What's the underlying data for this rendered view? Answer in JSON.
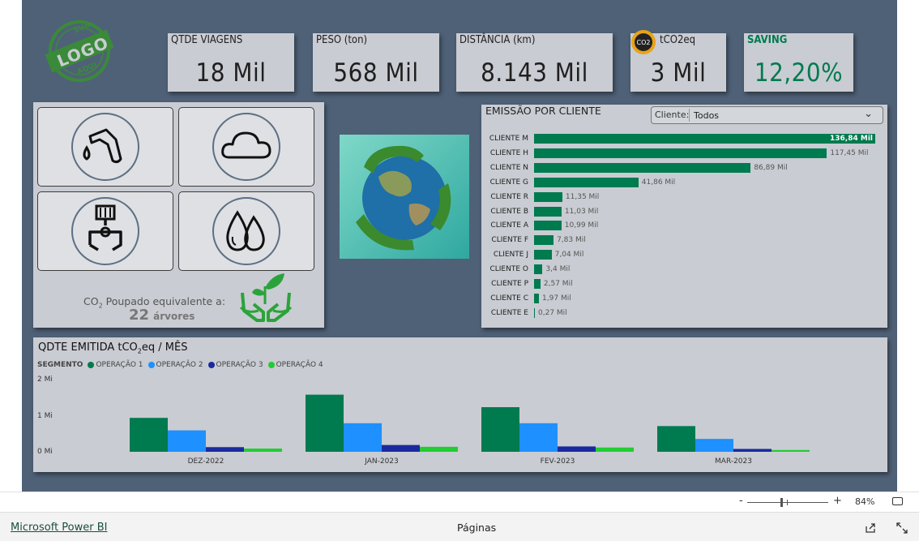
{
  "logo": {
    "line1": "SUA",
    "line2": "LOGO",
    "line3": "AQUI",
    "color": "#3a8a3a"
  },
  "kpis": [
    {
      "title": "QTDE VIAGENS",
      "value": "18 Mil"
    },
    {
      "title": "PESO (ton)",
      "value": "568 Mil"
    },
    {
      "title": "DISTÂNCIA (km)",
      "value": "8.143 Mil"
    },
    {
      "title": "tCO2eq",
      "value": "3 Mil",
      "badge": "CO2"
    },
    {
      "title": "SAVING",
      "value": "12,20%",
      "accent": "#007a4f"
    }
  ],
  "icons": [
    "fuel-pump-icon",
    "cloud-icon",
    "factory-claw-icon",
    "water-drops-icon"
  ],
  "co2_saved": {
    "label_prefix": "CO",
    "label_sub": "2",
    "label_suffix": " Poupado equivalente a:",
    "number": "22",
    "unit": "árvores"
  },
  "emission_by_client": {
    "title": "EMISSÃO POR CLIENTE",
    "filter_label": "Cliente:",
    "filter_value": "Todos",
    "clients": [
      "CLIENTE M",
      "CLIENTE H",
      "CLIENTE N",
      "CLIENTE G",
      "CLIENTE R",
      "CLIENTE B",
      "CLIENTE A",
      "CLIENTE F",
      "CLIENTE J",
      "CLIENTE O",
      "CLIENTE P",
      "CLIENTE C",
      "CLIENTE E"
    ],
    "values": [
      136.84,
      117.45,
      86.89,
      41.86,
      11.35,
      11.03,
      10.99,
      7.83,
      7.04,
      3.4,
      2.57,
      1.97,
      0.27
    ],
    "labels": [
      "136,84 Mil",
      "117,45 Mil",
      "86,89 Mil",
      "41,86 Mil",
      "11,35 Mil",
      "11,03 Mil",
      "10,99 Mil",
      "7,83 Mil",
      "7,04 Mil",
      "3,4 Mil",
      "2,57 Mil",
      "1,97 Mil",
      "0,27 Mil"
    ],
    "color": "#007a4f"
  },
  "monthly": {
    "title_prefix": "QDTE EMITIDA tCO",
    "title_sub": "2",
    "title_suffix": "eq / MÊS",
    "legend_title": "SEGMENTO",
    "series_names": [
      "OPERAÇÃO 1",
      "OPERAÇÃO 2",
      "OPERAÇÃO 3",
      "OPERAÇÃO 4"
    ],
    "series_colors": [
      "#007a4f",
      "#1e90ff",
      "#1a2a9e",
      "#22cc33"
    ],
    "y_ticks": [
      "2 Mi",
      "1 Mi",
      "0 Mi"
    ]
  },
  "chart_data": [
    {
      "type": "bar",
      "title": "EMISSÃO POR CLIENTE",
      "categories": [
        "CLIENTE M",
        "CLIENTE H",
        "CLIENTE N",
        "CLIENTE G",
        "CLIENTE R",
        "CLIENTE B",
        "CLIENTE A",
        "CLIENTE F",
        "CLIENTE J",
        "CLIENTE O",
        "CLIENTE P",
        "CLIENTE C",
        "CLIENTE E"
      ],
      "values": [
        136.84,
        117.45,
        86.89,
        41.86,
        11.35,
        11.03,
        10.99,
        7.83,
        7.04,
        3.4,
        2.57,
        1.97,
        0.27
      ],
      "orientation": "horizontal"
    },
    {
      "type": "bar",
      "title": "QDTE EMITIDA tCO2eq / MÊS",
      "categories": [
        "DEZ-2022",
        "JAN-2023",
        "FEV-2023",
        "MAR-2023"
      ],
      "series": [
        {
          "name": "OPERAÇÃO 1",
          "values": [
            0.95,
            1.6,
            1.25,
            0.72
          ]
        },
        {
          "name": "OPERAÇÃO 2",
          "values": [
            0.6,
            0.8,
            0.8,
            0.36
          ]
        },
        {
          "name": "OPERAÇÃO 3",
          "values": [
            0.13,
            0.19,
            0.15,
            0.08
          ]
        },
        {
          "name": "OPERAÇÃO 4",
          "values": [
            0.09,
            0.14,
            0.12,
            0.05
          ]
        }
      ],
      "ylim": [
        0,
        2
      ]
    }
  ],
  "statusbar": {
    "zoom_minus": "-",
    "zoom_plus": "+",
    "zoom_level": "84%",
    "zoom_fraction": 0.42
  },
  "footer": {
    "brand": "Microsoft Power BI",
    "pages": "Páginas"
  }
}
